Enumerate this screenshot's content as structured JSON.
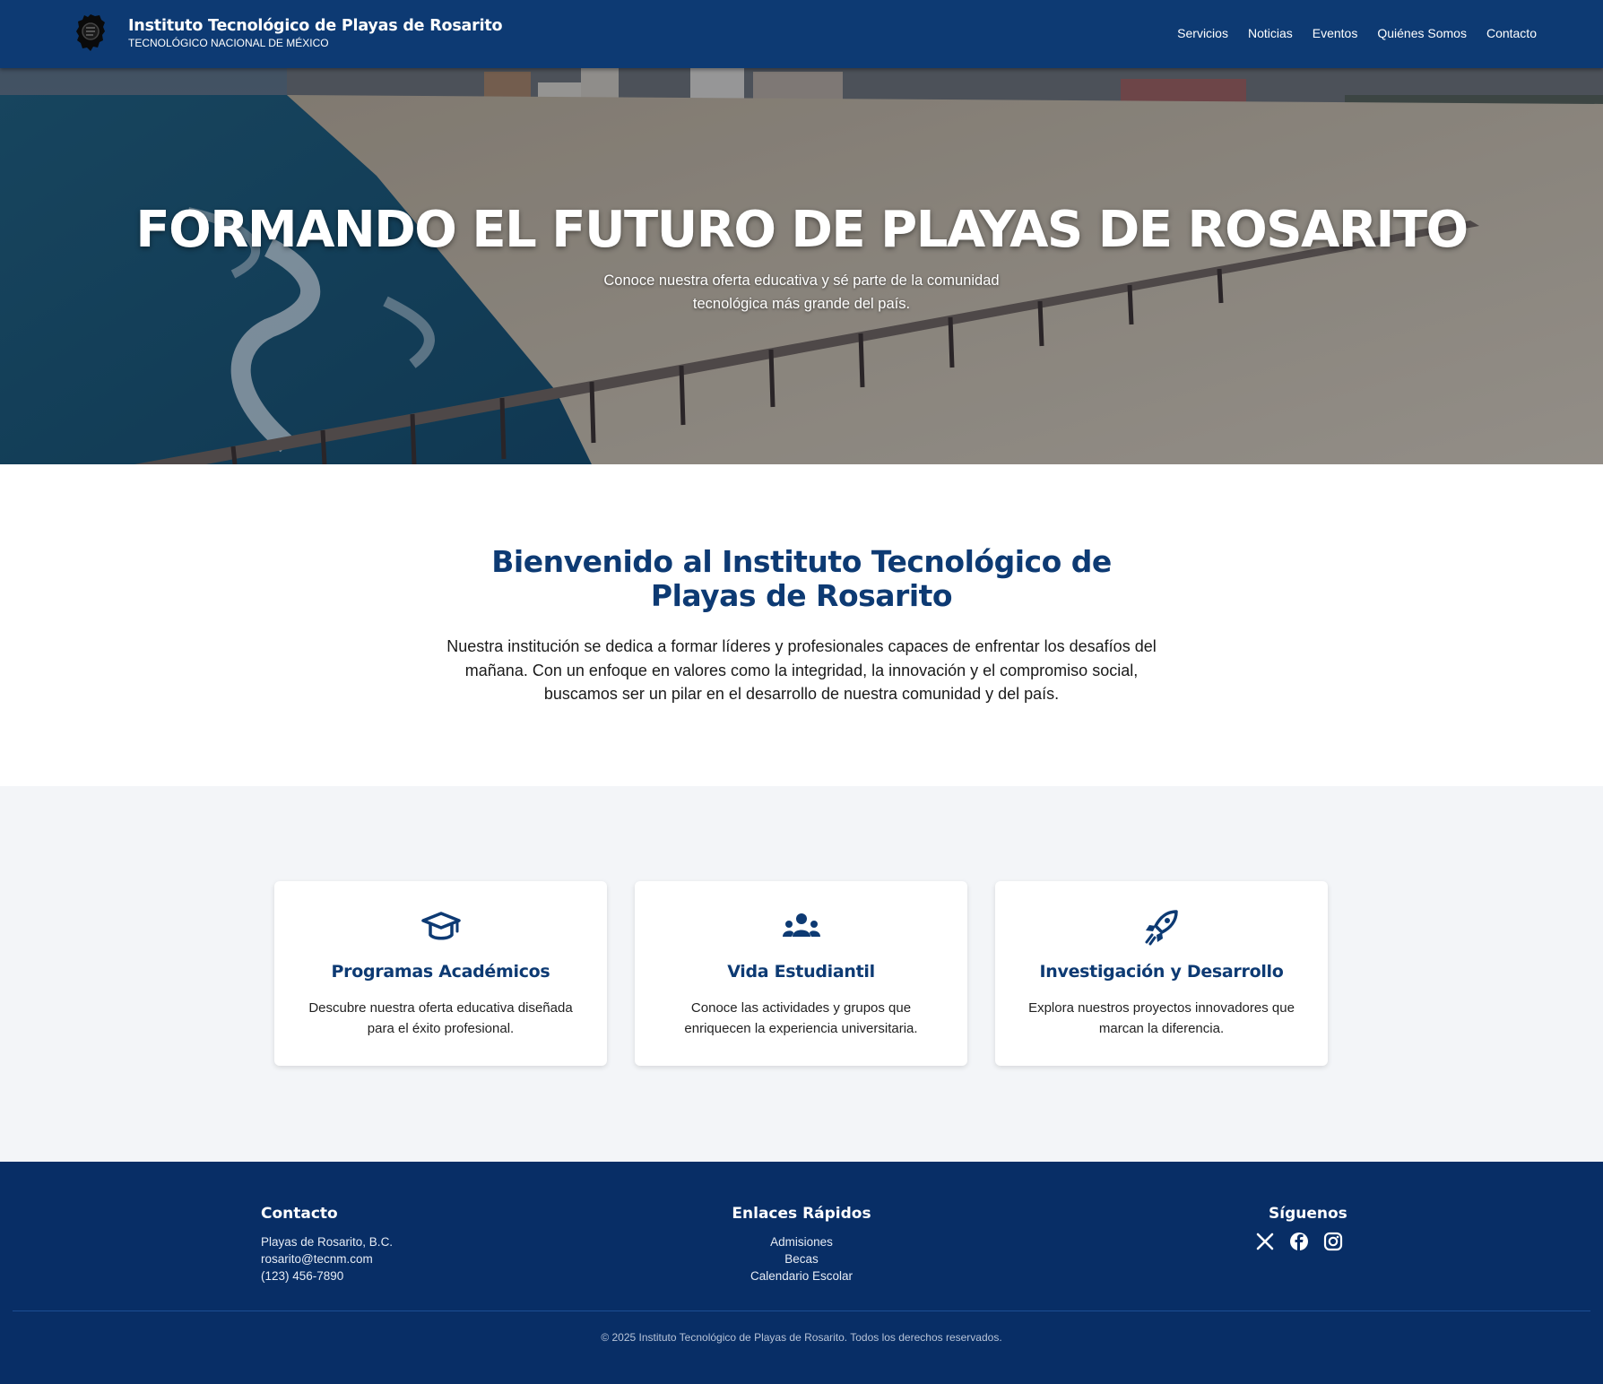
{
  "header": {
    "title": "Instituto Tecnológico de Playas de Rosarito",
    "subtitle": "TECNOLÓGICO NACIONAL DE MÉXICO",
    "nav": [
      "Servicios",
      "Noticias",
      "Eventos",
      "Quiénes Somos",
      "Contacto"
    ]
  },
  "hero": {
    "title": "FORMANDO EL FUTURO DE PLAYAS DE ROSARITO",
    "subtitle": "Conoce nuestra oferta educativa y sé parte de la comunidad tecnológica más grande del país."
  },
  "welcome": {
    "title": "Bienvenido al Instituto Tecnológico de Playas de Rosarito",
    "text": "Nuestra institución se dedica a formar líderes y profesionales capaces de enfrentar los desafíos del mañana. Con un enfoque en valores como la integridad, la innovación y el compromiso social, buscamos ser un pilar en el desarrollo de nuestra comunidad y del país."
  },
  "features": [
    {
      "icon": "graduation-cap-icon",
      "title": "Programas Académicos",
      "text": "Descubre nuestra oferta educativa diseñada para el éxito profesional."
    },
    {
      "icon": "users-icon",
      "title": "Vida Estudiantil",
      "text": "Conoce las actividades y grupos que enriquecen la experiencia universitaria."
    },
    {
      "icon": "rocket-icon",
      "title": "Investigación y Desarrollo",
      "text": "Explora nuestros proyectos innovadores que marcan la diferencia."
    }
  ],
  "footer": {
    "contact": {
      "heading": "Contacto",
      "lines": [
        "Playas de Rosarito, B.C.",
        "rosarito@tecnm.com",
        "(123) 456-7890"
      ]
    },
    "links": {
      "heading": "Enlaces Rápidos",
      "items": [
        "Admisiones",
        "Becas",
        "Calendario Escolar"
      ]
    },
    "social": {
      "heading": "Síguenos",
      "icons": [
        "x-icon",
        "facebook-icon",
        "instagram-icon"
      ]
    },
    "copyright": "© 2025 Instituto Tecnológico de Playas de Rosarito. Todos los derechos reservados."
  },
  "colors": {
    "primary": "#0d3a73",
    "footer": "#082e66",
    "section_bg": "#f3f5f8"
  }
}
